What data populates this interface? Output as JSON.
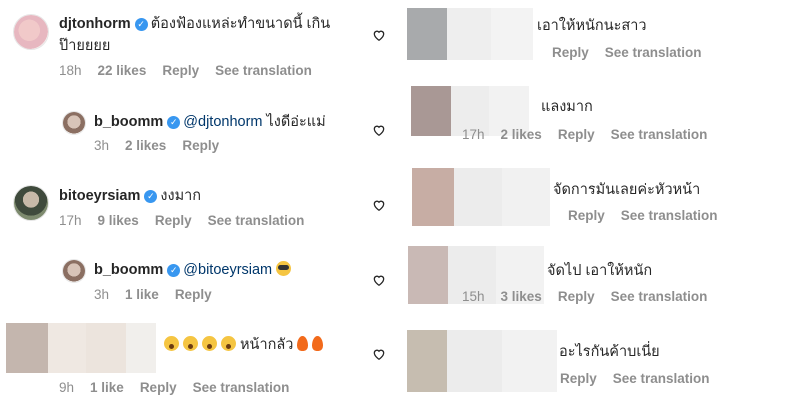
{
  "left": {
    "comments": [
      {
        "username": "djtonhorm",
        "text_line1": "ต้องฟ้องแหล่ะทำขนาดนี้ เกิน",
        "text_line2": "ป๊ายยยย",
        "time": "18h",
        "likes": "22 likes",
        "reply": "Reply",
        "translate": "See translation"
      },
      {
        "username": "b_boomm",
        "mention": "@djtonhorm",
        "text": "ไงดีอ่ะแม่",
        "time": "3h",
        "likes": "2 likes",
        "reply": "Reply"
      },
      {
        "username": "bitoeyrsiam",
        "text": "งงมาก",
        "time": "17h",
        "likes": "9 likes",
        "reply": "Reply",
        "translate": "See translation"
      },
      {
        "username": "b_boomm",
        "mention": "@bitoeyrsiam",
        "time": "3h",
        "likes": "1 like",
        "reply": "Reply"
      },
      {
        "text": "หน้ากลัว",
        "time": "9h",
        "likes": "1 like",
        "reply": "Reply",
        "translate": "See translation"
      }
    ]
  },
  "right": {
    "comments": [
      {
        "text": "เอาให้หนักนะสาว",
        "reply": "Reply",
        "translate": "See translation"
      },
      {
        "text": "แลงมาก",
        "time": "17h",
        "likes": "2 likes",
        "reply": "Reply",
        "translate": "See translation"
      },
      {
        "text": "จัดการมันเลยค่ะหัวหน้า",
        "reply": "Reply",
        "translate": "See translation"
      },
      {
        "text": "จัดไป เอาให้หนัก",
        "time": "15h",
        "likes": "3 likes",
        "reply": "Reply",
        "translate": "See translation"
      },
      {
        "text": "อะไรกันค้าบเนี่ย",
        "reply": "Reply",
        "translate": "See translation"
      }
    ]
  },
  "colors": {
    "text": "#262626",
    "meta": "#8e8e8e",
    "mention": "#00376b",
    "verified": "#3897f0"
  },
  "icons": [
    "heart-icon",
    "verified-badge-icon"
  ]
}
